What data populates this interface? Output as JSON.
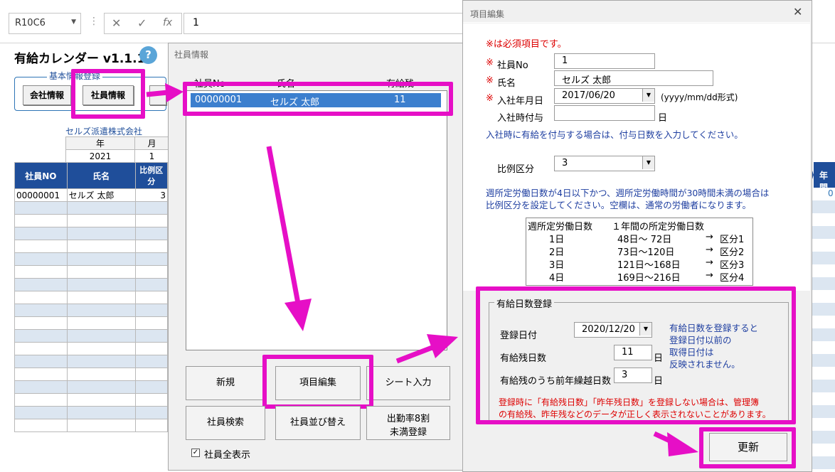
{
  "formula_bar": {
    "name_box": "R10C6",
    "cancel_icon": "✕",
    "enter_icon": "✓",
    "fx_icon": "fx",
    "content": "1"
  },
  "sheet": {
    "title": "有給カレンダー v1.1.1",
    "help_icon": "?",
    "basic_group_label": "基本情報登録",
    "company_button": "会社情報",
    "employee_button": "社員情報",
    "company_name": "セルズ派遣株式会社",
    "year_header": "年",
    "month_header": "月",
    "year_value": "2021",
    "month_value": "1",
    "columns": [
      "社員NO",
      "氏名",
      "比例区分"
    ],
    "rows": [
      {
        "no": "00000001",
        "name": "セルズ 太郎",
        "ratio": "3"
      }
    ],
    "right_header": "年間",
    "right_value": "0"
  },
  "employee_window": {
    "title": "社員情報",
    "list_headers": [
      "社員No",
      "氏名",
      "有給残"
    ],
    "selected_row": {
      "no": "00000001",
      "name": "セルズ 太郎",
      "remaining": "11"
    },
    "buttons": {
      "new": "新規",
      "edit": "項目編集",
      "sheet_input": "シート入力",
      "search": "社員検索",
      "sort": "社員並び替え",
      "attendance_line1": "出勤率8割",
      "attendance_line2": "未満登録"
    },
    "show_all_label": "社員全表示",
    "show_all_checked": true
  },
  "item_window": {
    "title": "項目編集",
    "close_icon": "✕",
    "required_note": "※は必須項目です。",
    "required_mark": "※",
    "employee_no_label": "社員No",
    "employee_no_value": "1",
    "name_label": "氏名",
    "name_value": "セルズ 太郎",
    "join_date_label": "入社年月日",
    "join_date_value": "2017/06/20",
    "join_date_format": "(yyyy/mm/dd形式)",
    "join_grant_label": "入社時付与",
    "join_grant_value": "",
    "day_unit": "日",
    "join_grant_note": "入社時に有給を付与する場合は、付与日数を入力してください。",
    "ratio_label": "比例区分",
    "ratio_value": "3",
    "ratio_note_line1": "週所定労働日数が4日以下かつ、週所定労働時間が30時間未満の場合は",
    "ratio_note_line2": "比例区分を設定してください。空欄は、通常の労働者になります。",
    "ratio_table": {
      "header_left": "週所定労働日数",
      "header_right": "１年間の所定労働日数",
      "rows": [
        {
          "days": "1日",
          "range": "48日～ 72日",
          "arrow": "→",
          "category": "区分1"
        },
        {
          "days": "2日",
          "range": "73日～120日",
          "arrow": "→",
          "category": "区分2"
        },
        {
          "days": "3日",
          "range": "121日～168日",
          "arrow": "→",
          "category": "区分3"
        },
        {
          "days": "4日",
          "range": "169日～216日",
          "arrow": "→",
          "category": "区分4"
        }
      ]
    },
    "paid_group_label": "有給日数登録",
    "register_date_label": "登録日付",
    "register_date_value": "2020/12/20",
    "remaining_label": "有給残日数",
    "remaining_value": "11",
    "carryover_label": "有給残のうち前年繰越日数",
    "carryover_value": "3",
    "register_note_lines": [
      "有給日数を登録すると",
      "登録日付以前の",
      "取得日付は",
      "反映されません。"
    ],
    "warning_line1": "登録時に「有給残日数」「昨年残日数」を登録しない場合は、管理簿",
    "warning_line2": "の有給残、昨年残などのデータが正しく表示されないことがあります。",
    "update_button": "更新"
  },
  "colors": {
    "highlight": "#e60fc6",
    "header_blue": "#1f4e9a",
    "selection_blue": "#3c7fce",
    "required_red": "#dd0000"
  }
}
